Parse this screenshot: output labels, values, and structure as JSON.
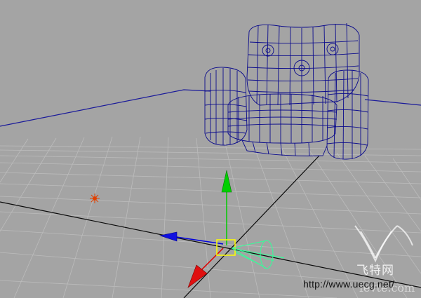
{
  "viewport": {
    "background": "#a4a4a4",
    "grid_color": "#b9b9b9",
    "axis_line_color": "#000000",
    "horizon_color": "#1a1aa0"
  },
  "model": {
    "name": "armchair",
    "display": "wireframe",
    "wire_color": "#0b0b8c"
  },
  "manipulator": {
    "type": "move-tool",
    "x_color": "#0000dd",
    "y_color": "#00cc00",
    "z_color": "#dd0000",
    "center_color": "#ffff00",
    "camera_color": "#33ffaa"
  },
  "light": {
    "name": "point-light",
    "color": "#e04000"
  },
  "watermark": {
    "url": "http://www.uecg.net/",
    "site_cn": "飞特网",
    "site_en": "fevte.com"
  }
}
